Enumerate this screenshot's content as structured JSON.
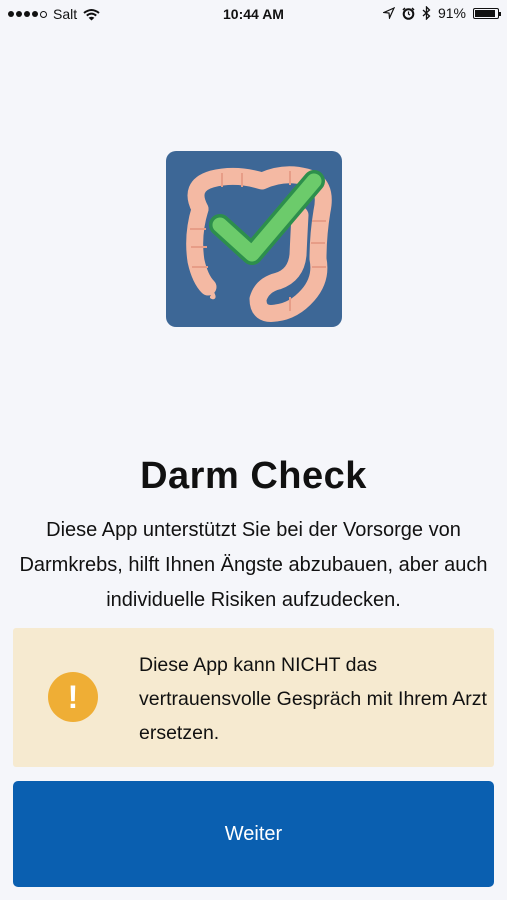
{
  "status_bar": {
    "carrier": "Salt",
    "time": "10:44 AM",
    "battery_percent": "91%",
    "battery_level": 0.91,
    "icons": [
      "signal-dots-icon",
      "wifi-icon",
      "location-arrow-icon",
      "alarm-icon",
      "bluetooth-icon",
      "battery-icon"
    ]
  },
  "app": {
    "icon": "colon-checkmark-icon",
    "title": "Darm Check",
    "description": "Diese App unterstützt Sie bei der Vorsorge von Darmkrebs, hilft Ihnen Ängste abzubauen, aber auch individuelle Risiken aufzudecken."
  },
  "warning": {
    "icon_glyph": "!",
    "text": "Diese App kann NICHT das vertrauensvolle Gespräch mit Ihrem Arzt ersetzen."
  },
  "actions": {
    "continue_label": "Weiter"
  },
  "colors": {
    "background": "#f5f6fa",
    "icon_background": "#3d6796",
    "warning_background": "#f6ead0",
    "warning_icon": "#efae35",
    "button": "#0a5fb0"
  }
}
